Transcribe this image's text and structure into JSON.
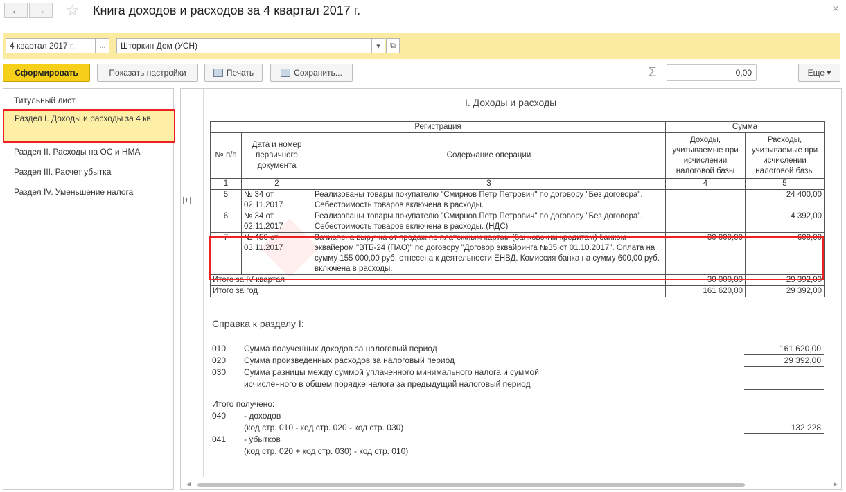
{
  "window": {
    "title": "Книга доходов и расходов за 4 квартал 2017 г.",
    "back_icon": "←",
    "forward_icon": "→",
    "close_icon": "×"
  },
  "params": {
    "period_value": "4 квартал 2017 г.",
    "period_choose": "...",
    "org_value": "Шторкин Дом (УСН)",
    "org_dropdown": "▾",
    "org_open": "⧉"
  },
  "toolbar": {
    "generate_label": "Сформировать",
    "settings_label": "Показать настройки",
    "print_label": "Печать",
    "save_label": "Сохранить...",
    "sum_symbol": "Σ",
    "sum_value": "0,00",
    "more_label": "Еще ▾"
  },
  "nav": {
    "items": [
      {
        "label": "Титульный лист"
      },
      {
        "label": "Раздел I. Доходы и расходы за 4 кв."
      },
      {
        "label": "Раздел II. Расходы на ОС и НМА"
      },
      {
        "label": "Раздел III. Расчет убытка"
      },
      {
        "label": "Раздел IV. Уменьшение налога"
      }
    ],
    "selected_index": 1
  },
  "report": {
    "title": "I. Доходы и расходы",
    "headers": {
      "registration": "Регистрация",
      "sum": "Сумма",
      "num": "№ п/п",
      "doc": "Дата и номер первичного документа",
      "content": "Содержание операции",
      "income": "Доходы, учитываемые при исчислении налоговой базы",
      "expense": "Расходы, учитываемые при исчислении налоговой базы",
      "col1": "1",
      "col2": "2",
      "col3": "3",
      "col4": "4",
      "col5": "5"
    },
    "rows": [
      {
        "num": "5",
        "doc": "№ 34 от 02.11.2017",
        "content": "Реализованы товары покупателю \"Смирнов Петр Петрович\" по договору \"Без договора\". Себестоимость товаров включена в расходы.",
        "income": "",
        "expense": "24 400,00"
      },
      {
        "num": "6",
        "doc": "№ 34 от 02.11.2017",
        "content": "Реализованы товары покупателю \"Смирнов Петр Петрович\" по договору \"Без договора\". Себестоимость товаров включена в расходы. (НДС)",
        "income": "",
        "expense": "4 392,00"
      },
      {
        "num": "7",
        "doc": "№ 450 от 03.11.2017",
        "content": "Зачислена выручка от продаж по платежным картам (банковским кредитам) банком-эквайером \"ВТБ-24 (ПАО)\" по договору \"Договор эквайринга №35 от 01.10.2017\". Оплата на сумму 155 000,00 руб. отнесена к деятельности ЕНВД. Комиссия банка на сумму 600,00 руб. включена в расходы.",
        "income": "30 000,00",
        "expense": "600,00"
      }
    ],
    "total_quarter": {
      "label": "Итого за IV квартал",
      "income": "30 000,00",
      "expense": "29 392,00"
    },
    "total_year": {
      "label": "Итого за год",
      "income": "161 620,00",
      "expense": "29 392,00"
    }
  },
  "sprav": {
    "title": "Справка к разделу I:",
    "l010": {
      "code": "010",
      "text": "Сумма полученных доходов за налоговый период",
      "value": "161 620,00"
    },
    "l020": {
      "code": "020",
      "text": "Сумма произведенных  расходов за налоговый период",
      "value": "29 392,00"
    },
    "l030": {
      "code": "030",
      "text1": "Сумма разницы между  суммой уплаченного минимального налога и суммой",
      "text2": "исчисленного в общем порядке налога за предыдущий налоговый период",
      "value": ""
    },
    "received": "Итого получено:",
    "l040": {
      "code": "040",
      "text1": "- доходов",
      "text2": "(код стр. 010 - код  стр. 020 - код стр. 030)",
      "value": "132 228"
    },
    "l041": {
      "code": "041",
      "text1": "- убытков",
      "text2": "(код стр. 020 + код  стр. 030) - код стр. 010)",
      "value": ""
    }
  }
}
